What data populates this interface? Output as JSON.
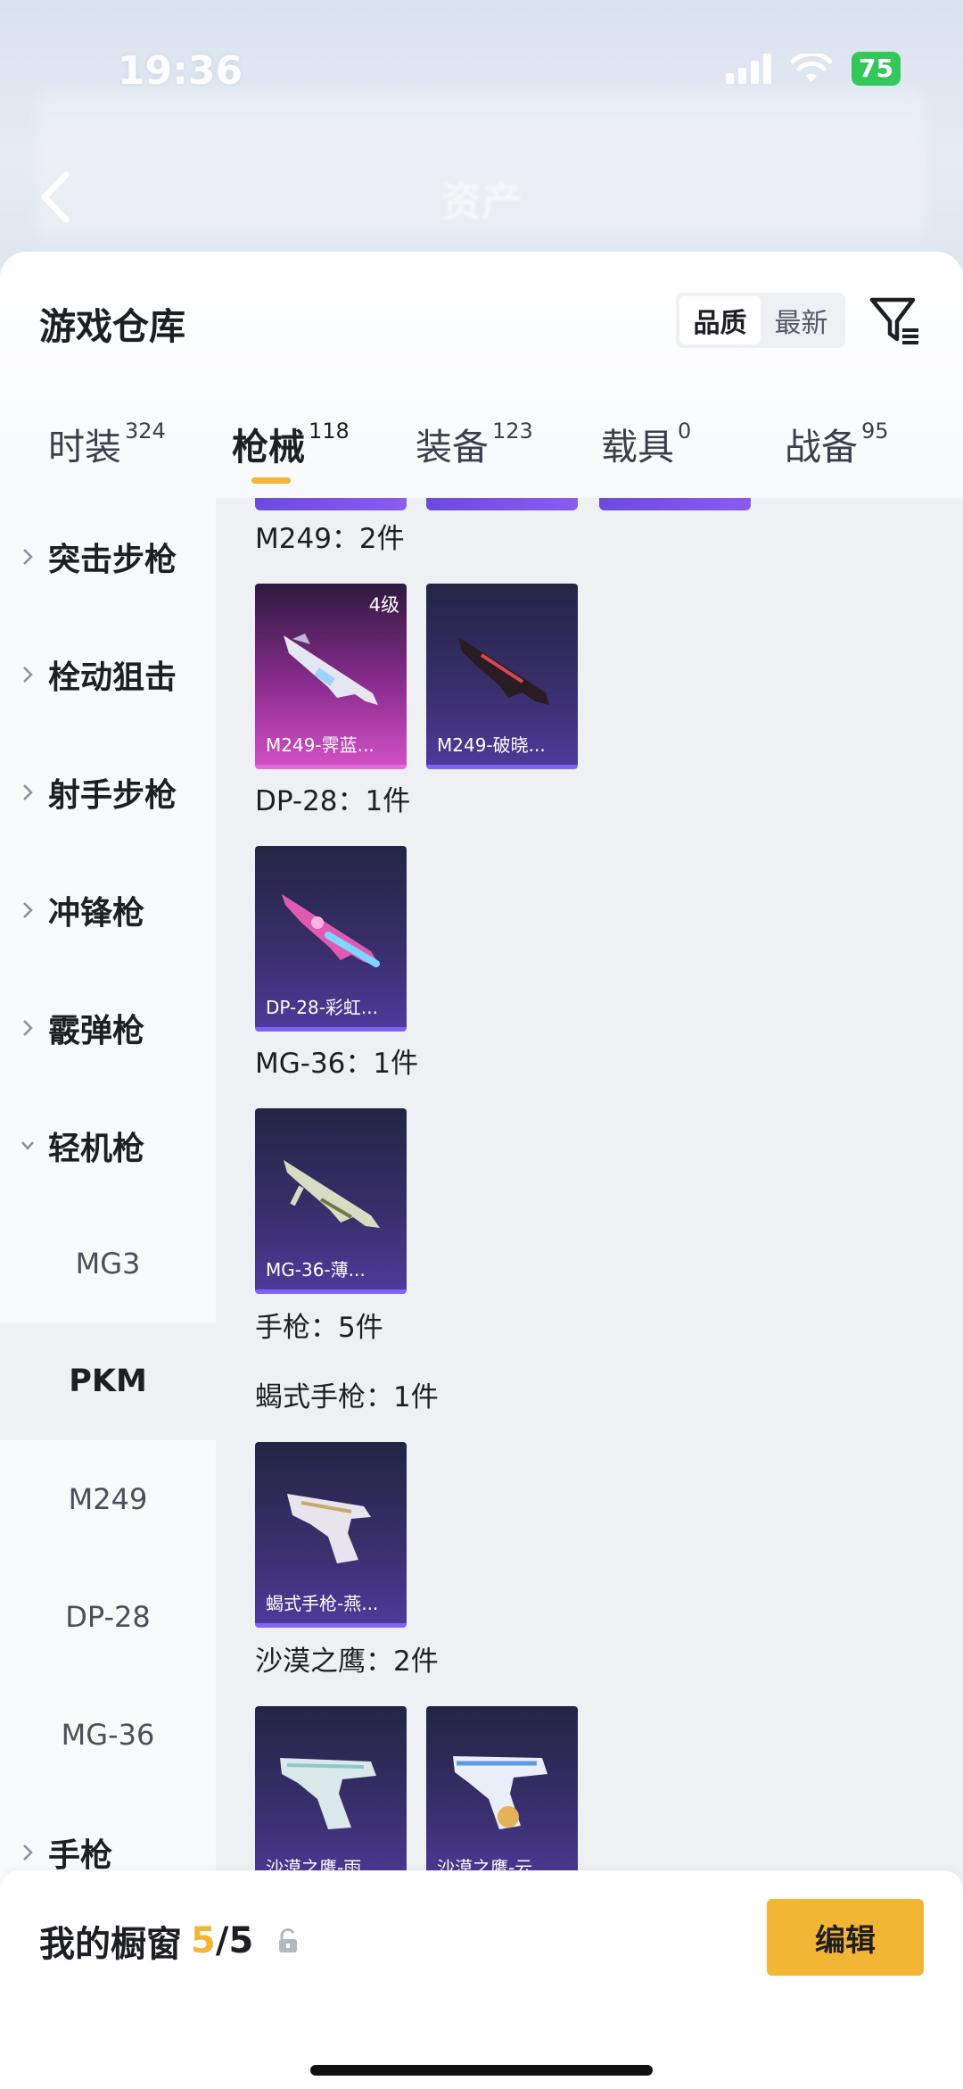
{
  "status_bar": {
    "time": "19:36",
    "battery": "75"
  },
  "header": {
    "title": "资产"
  },
  "panel": {
    "title": "游戏仓库",
    "sort_options": [
      {
        "label": "品质",
        "active": true
      },
      {
        "label": "最新",
        "active": false
      }
    ]
  },
  "tabs": [
    {
      "label": "时装",
      "count": "324",
      "active": false
    },
    {
      "label": "枪械",
      "count": "118",
      "active": true
    },
    {
      "label": "装备",
      "count": "123",
      "active": false
    },
    {
      "label": "载具",
      "count": "0",
      "active": false
    },
    {
      "label": "战备",
      "count": "95",
      "active": false
    }
  ],
  "sidebar": {
    "categories": [
      {
        "label": "突击步枪",
        "expanded": false
      },
      {
        "label": "栓动狙击",
        "expanded": false
      },
      {
        "label": "射手步枪",
        "expanded": false
      },
      {
        "label": "冲锋枪",
        "expanded": false
      },
      {
        "label": "霰弹枪",
        "expanded": false
      },
      {
        "label": "轻机枪",
        "expanded": true
      },
      {
        "label": "手枪",
        "expanded": false
      }
    ],
    "subitems": [
      {
        "label": "MG3",
        "active": false
      },
      {
        "label": "PKM",
        "active": true
      },
      {
        "label": "M249",
        "active": false
      },
      {
        "label": "DP-28",
        "active": false
      },
      {
        "label": "MG-36",
        "active": false
      }
    ]
  },
  "content": {
    "groups": [
      {
        "label": "M249：2件",
        "items": [
          {
            "name": "M249-霁蓝...",
            "level": "4级",
            "style": "pink"
          },
          {
            "name": "M249-破晓...",
            "style": "purple"
          }
        ]
      },
      {
        "label": "DP-28：1件",
        "items": [
          {
            "name": "DP-28-彩虹...",
            "style": "purple"
          }
        ]
      },
      {
        "label": "MG-36：1件",
        "items": [
          {
            "name": "MG-36-薄...",
            "style": "purple"
          }
        ]
      },
      {
        "label": "手枪：5件",
        "items": []
      },
      {
        "label": "蝎式手枪：1件",
        "items": [
          {
            "name": "蝎式手枪-燕...",
            "style": "purple"
          }
        ]
      },
      {
        "label": "沙漠之鹰：2件",
        "items": [
          {
            "name": "沙漠之鹰-雨...",
            "style": "purple"
          },
          {
            "name": "沙漠之鹰-云...",
            "style": "purple"
          }
        ]
      }
    ]
  },
  "bottom_bar": {
    "showcase_label": "我的橱窗",
    "showcase_used": "5",
    "showcase_sep": "/",
    "showcase_total": "5",
    "edit_label": "编辑"
  },
  "colors": {
    "accent": "#f2b534",
    "card_purple": "#4e3a9a",
    "card_pink": "#d04fc4",
    "battery": "#34c759"
  }
}
